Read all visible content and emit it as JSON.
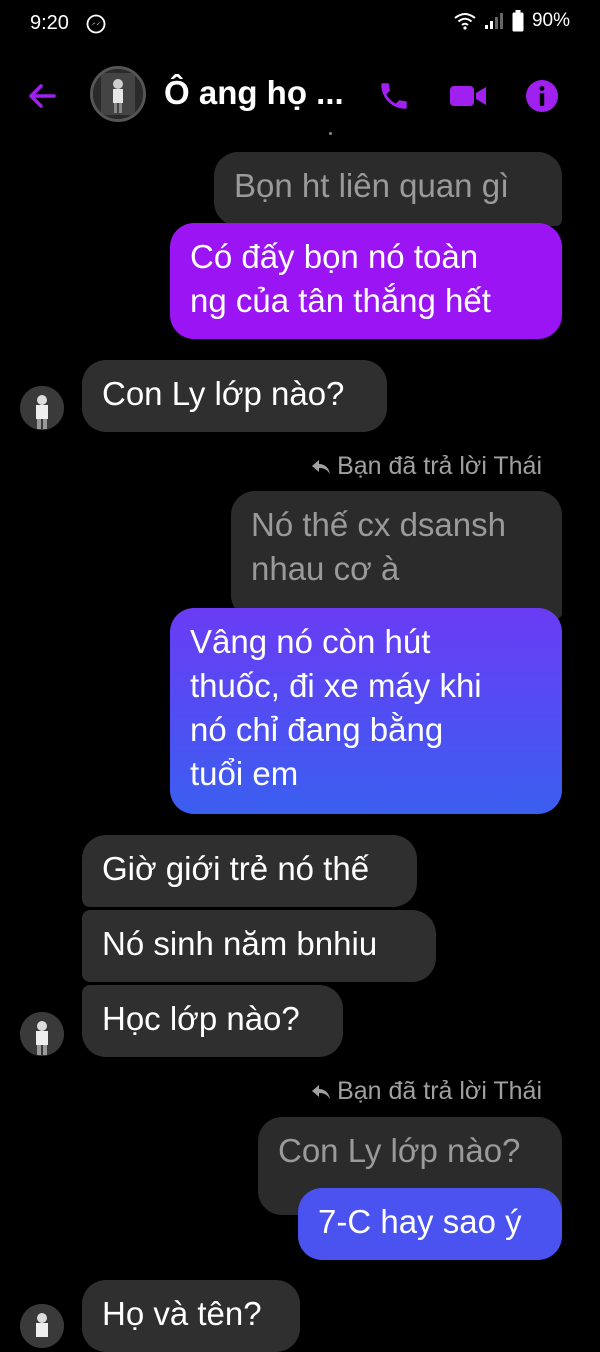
{
  "status_bar": {
    "time": "9:20",
    "battery": "90%"
  },
  "header": {
    "title": "Ô ang họ ..."
  },
  "messages": {
    "q1": "Bọn ht liên quan gì",
    "m1": "Có đấy bọn nó toàn\nng của tân thắng hết",
    "m2": "Con Ly lớp nào?",
    "reply_label_1": "Bạn đã trả lời Thái",
    "q2": "Nó thế cx dsansh\nnhau cơ à",
    "m3": "Vâng nó còn hút\nthuốc, đi xe máy khi\nnó chỉ đang bằng\ntuổi em",
    "m4": "Giờ giới trẻ nó thế",
    "m5": "Nó sinh năm bnhiu",
    "m6": "Học lớp nào?",
    "reply_label_2": "Bạn đã trả lời Thái",
    "q3": "Con Ly lớp nào?",
    "m7": "7-C hay sao ý",
    "m8": "Họ và tên?"
  },
  "colors": {
    "accent": "#a020f0",
    "sent_purple": "#9b14f3",
    "sent_blue": "#4a52ef",
    "received": "#2f2f2f"
  },
  "icons": [
    "messenger-icon",
    "wifi-icon",
    "signal-icon",
    "battery-icon",
    "back-arrow-icon",
    "phone-icon",
    "video-icon",
    "info-icon",
    "reply-icon"
  ]
}
